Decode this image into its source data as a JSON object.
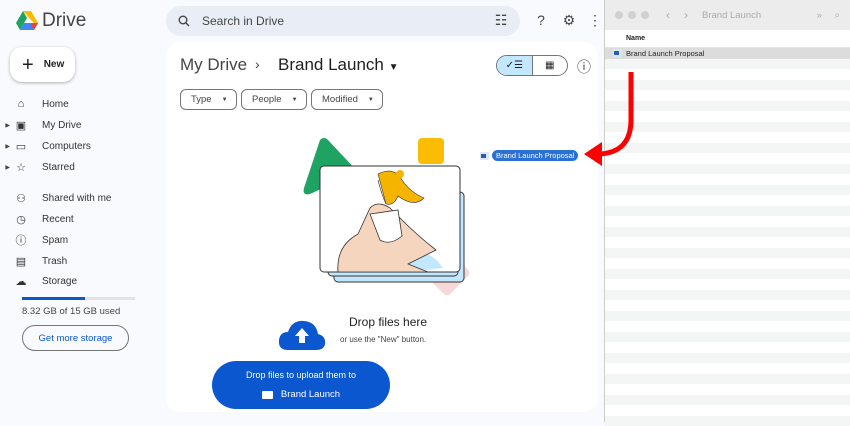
{
  "header": {
    "app_name": "Drive",
    "search_placeholder": "Search in Drive"
  },
  "sidebar": {
    "new_label": "New",
    "items": [
      {
        "label": "Home",
        "icon": "home-icon"
      },
      {
        "label": "My Drive",
        "icon": "my-drive-icon"
      },
      {
        "label": "Computers",
        "icon": "computers-icon"
      },
      {
        "label": "Starred",
        "icon": "star-icon"
      },
      {
        "label": "Shared with me",
        "icon": "shared-icon"
      },
      {
        "label": "Recent",
        "icon": "clock-icon"
      },
      {
        "label": "Spam",
        "icon": "spam-icon"
      },
      {
        "label": "Trash",
        "icon": "trash-icon"
      },
      {
        "label": "Storage",
        "icon": "cloud-icon"
      }
    ],
    "storage_used_fraction": 0.555,
    "storage_text": "8.32 GB of 15 GB used",
    "get_more_label": "Get more storage"
  },
  "main": {
    "breadcrumb_root": "My Drive",
    "breadcrumb_current": "Brand Launch",
    "filters": [
      "Type",
      "People",
      "Modified"
    ],
    "drop_title": "Drop files here",
    "drop_subtitle": "or use the \"New\" button.",
    "upload_line1": "Drop files to upload them to",
    "upload_folder": "Brand Launch",
    "dragged_file": "Brand Launch Proposal"
  },
  "finder": {
    "title": "Brand Launch",
    "column_name": "Name",
    "files": [
      "Brand Launch Proposal"
    ]
  },
  "colors": {
    "accent": "#0b57d0",
    "arrow": "#ff0000"
  }
}
